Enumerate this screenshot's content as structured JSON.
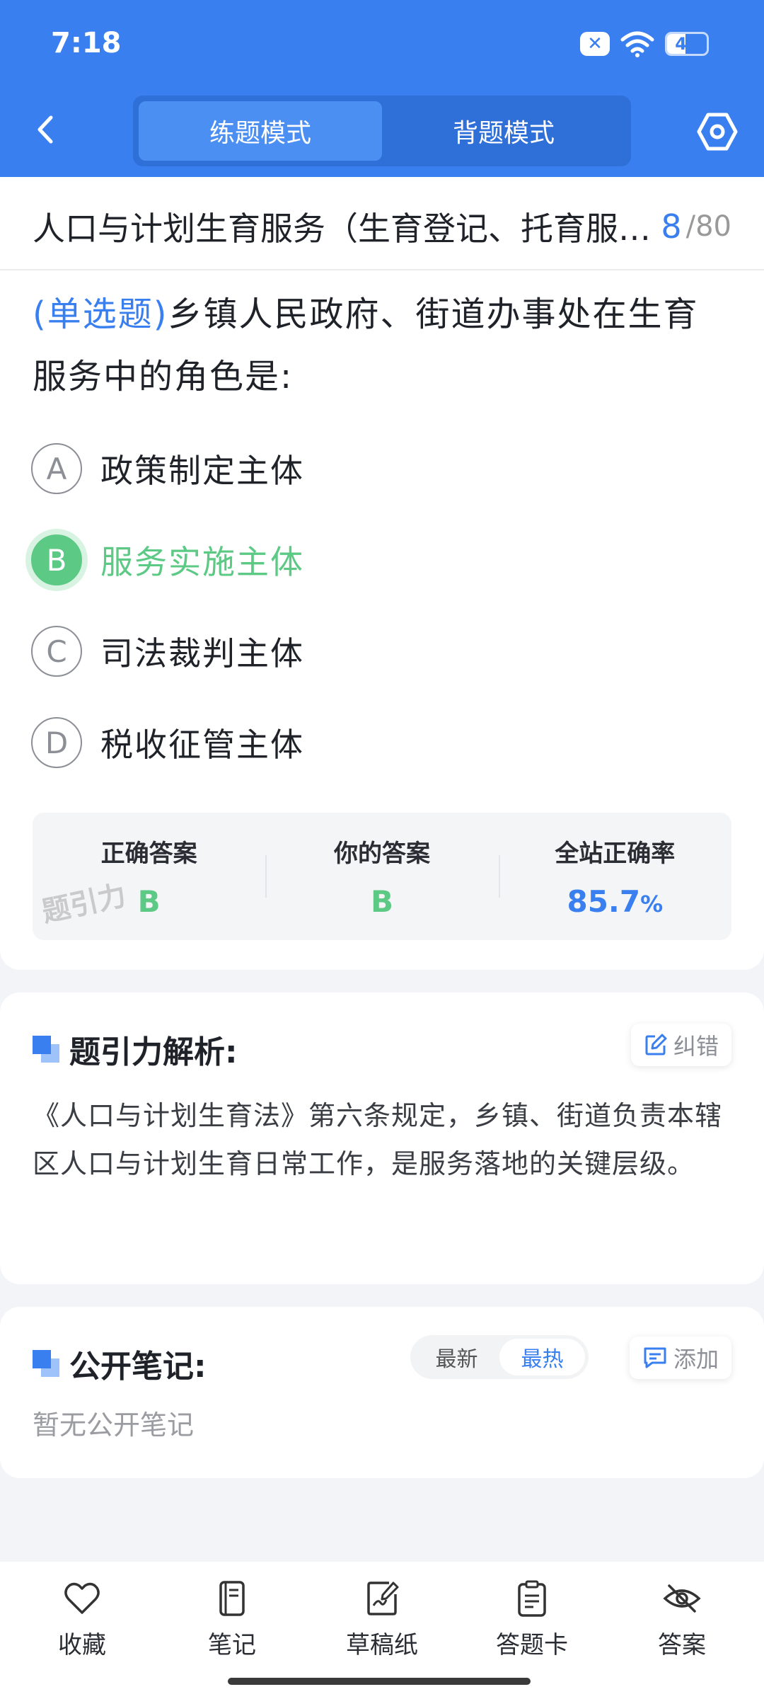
{
  "status_bar": {
    "time": "7:18",
    "battery_level": 47,
    "battery_text": "47",
    "sim_icon": "x",
    "icons": [
      "sim-blocked-icon",
      "wifi-icon",
      "battery-icon"
    ]
  },
  "header": {
    "back_icon": "chevron-left-icon",
    "tabs": [
      {
        "label": "练题模式",
        "active": true
      },
      {
        "label": "背题模式",
        "active": false
      }
    ],
    "settings_icon": "settings-hex-icon",
    "accent_color": "#3a7ff0"
  },
  "question": {
    "section_title": "人口与计划生育服务（生育登记、托育服务、生育保险）",
    "current_index": "8",
    "total": "80",
    "type_label": "(单选题)",
    "text": "乡镇人民政府、街道办事处在生育服务中的角色是:",
    "options": [
      {
        "letter": "A",
        "text": "政策制定主体",
        "state": "normal"
      },
      {
        "letter": "B",
        "text": "服务实施主体",
        "state": "correct"
      },
      {
        "letter": "C",
        "text": "司法裁判主体",
        "state": "normal"
      },
      {
        "letter": "D",
        "text": "税收征管主体",
        "state": "normal"
      }
    ],
    "correct_color": "#5cc985"
  },
  "stats": {
    "correct_answer_label": "正确答案",
    "correct_answer": "B",
    "your_answer_label": "你的答案",
    "your_answer": "B",
    "site_rate_label": "全站正确率",
    "site_rate_value": "85.7",
    "site_rate_unit": "%",
    "watermark": "题引力"
  },
  "analysis": {
    "title": "题引力解析:",
    "report_button": "纠错",
    "text": "《人口与计划生育法》第六条规定，乡镇、街道负责本辖区人口与计划生育日常工作，是服务落地的关键层级。"
  },
  "notes": {
    "title": "公开笔记:",
    "sort_options": [
      {
        "label": "最新",
        "active": false
      },
      {
        "label": "最热",
        "active": true
      }
    ],
    "add_button": "添加",
    "empty_text": "暂无公开笔记"
  },
  "bottom_bar": {
    "items": [
      {
        "label": "收藏",
        "icon": "heart-icon"
      },
      {
        "label": "笔记",
        "icon": "notebook-icon"
      },
      {
        "label": "草稿纸",
        "icon": "draft-paper-icon"
      },
      {
        "label": "答题卡",
        "icon": "answer-card-icon"
      },
      {
        "label": "答案",
        "icon": "eye-off-icon"
      }
    ]
  }
}
